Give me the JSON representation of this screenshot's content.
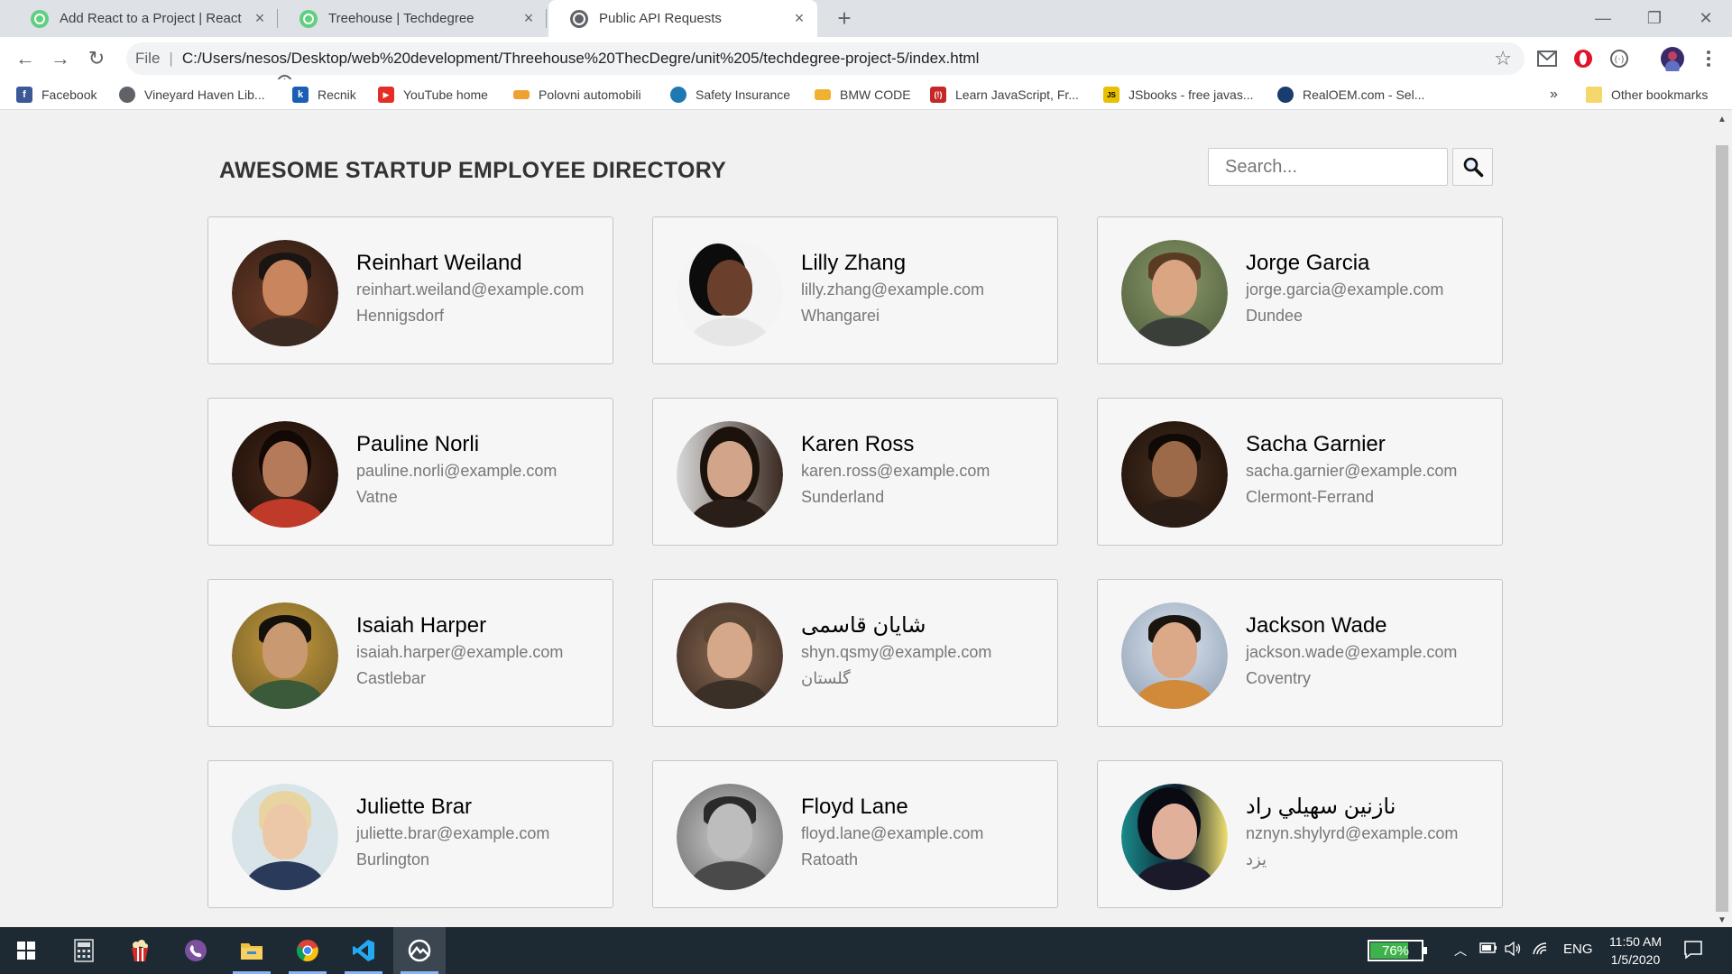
{
  "browser": {
    "tabs": [
      {
        "label": "Add React to a Project | React Ba",
        "close": "×",
        "favicon": "treehouse-icon"
      },
      {
        "label": "Treehouse | Techdegree",
        "close": "×",
        "favicon": "treehouse-icon"
      },
      {
        "label": "Public API Requests",
        "close": "×",
        "favicon": "globe-icon",
        "active": true
      }
    ],
    "new_tab": "+",
    "window_controls": {
      "minimize": "—",
      "restore": "❐",
      "close": "✕"
    },
    "nav": {
      "back": "←",
      "forward": "→",
      "reload": "↻"
    },
    "address": {
      "scheme": "File",
      "separator": "|",
      "url": "C:/Users/nesos/Desktop/web%20development/Threehouse%20ThecDegre/unit%205/techdegree-project-5/index.html",
      "star": "☆"
    },
    "bookmarks": [
      {
        "label": "Facebook",
        "icon": "facebook-icon",
        "color": "#3b5998",
        "glyph": "f"
      },
      {
        "label": "Vineyard Haven Lib...",
        "icon": "globe-icon",
        "color": "#5f6368",
        "glyph": ""
      },
      {
        "label": "Recnik",
        "icon": "k-icon",
        "color": "#1a5fb4",
        "glyph": "k"
      },
      {
        "label": "YouTube home",
        "icon": "youtube-icon",
        "color": "#e52d27",
        "glyph": "▶"
      },
      {
        "label": "Polovni automobili",
        "icon": "car-icon",
        "color": "#f0a030",
        "glyph": ""
      },
      {
        "label": "Safety Insurance",
        "icon": "insurance-icon",
        "color": "#1f78b4",
        "glyph": ""
      },
      {
        "label": "BMW CODE",
        "icon": "folder-icon",
        "color": "#f0b030",
        "glyph": ""
      },
      {
        "label": "Learn JavaScript, Fr...",
        "icon": "freecodecamp-icon",
        "color": "#c62828",
        "glyph": "(!)"
      },
      {
        "label": "JSbooks - free javas...",
        "icon": "js-icon",
        "color": "#e8c000",
        "glyph": "JS"
      },
      {
        "label": "RealOEM.com - Sel...",
        "icon": "bmw-icon",
        "color": "#1a3d6e",
        "glyph": ""
      }
    ],
    "bookmarks_overflow": "»",
    "other_bookmarks": "Other bookmarks"
  },
  "page": {
    "title": "AWESOME STARTUP EMPLOYEE DIRECTORY",
    "search": {
      "placeholder": "Search...",
      "button_icon": "magnifier-icon"
    }
  },
  "employees": [
    {
      "name": "Reinhart Weiland",
      "email": "reinhart.weiland@example.com",
      "city": "Hennigsdorf"
    },
    {
      "name": "Lilly Zhang",
      "email": "lilly.zhang@example.com",
      "city": "Whangarei"
    },
    {
      "name": "Jorge Garcia",
      "email": "jorge.garcia@example.com",
      "city": "Dundee"
    },
    {
      "name": "Pauline Norli",
      "email": "pauline.norli@example.com",
      "city": "Vatne"
    },
    {
      "name": "Karen Ross",
      "email": "karen.ross@example.com",
      "city": "Sunderland"
    },
    {
      "name": "Sacha Garnier",
      "email": "sacha.garnier@example.com",
      "city": "Clermont-Ferrand"
    },
    {
      "name": "Isaiah Harper",
      "email": "isaiah.harper@example.com",
      "city": "Castlebar"
    },
    {
      "name": "شایان قاسمی",
      "email": "shyn.qsmy@example.com",
      "city": "گلستان"
    },
    {
      "name": "Jackson Wade",
      "email": "jackson.wade@example.com",
      "city": "Coventry"
    },
    {
      "name": "Juliette Brar",
      "email": "juliette.brar@example.com",
      "city": "Burlington"
    },
    {
      "name": "Floyd Lane",
      "email": "floyd.lane@example.com",
      "city": "Ratoath"
    },
    {
      "name": "نازنین سهيلي راد",
      "email": "nznyn.shylyrd@example.com",
      "city": "یزد"
    }
  ],
  "taskbar": {
    "apps": [
      "windows-start-icon",
      "calculator-icon",
      "popcorn-icon",
      "viber-icon",
      "file-explorer-icon",
      "chrome-icon",
      "vscode-icon",
      "app-icon"
    ],
    "battery": {
      "label": "76%",
      "level": 0.76
    },
    "language": "ENG",
    "time": "11:50 AM",
    "date": "1/5/2020"
  }
}
